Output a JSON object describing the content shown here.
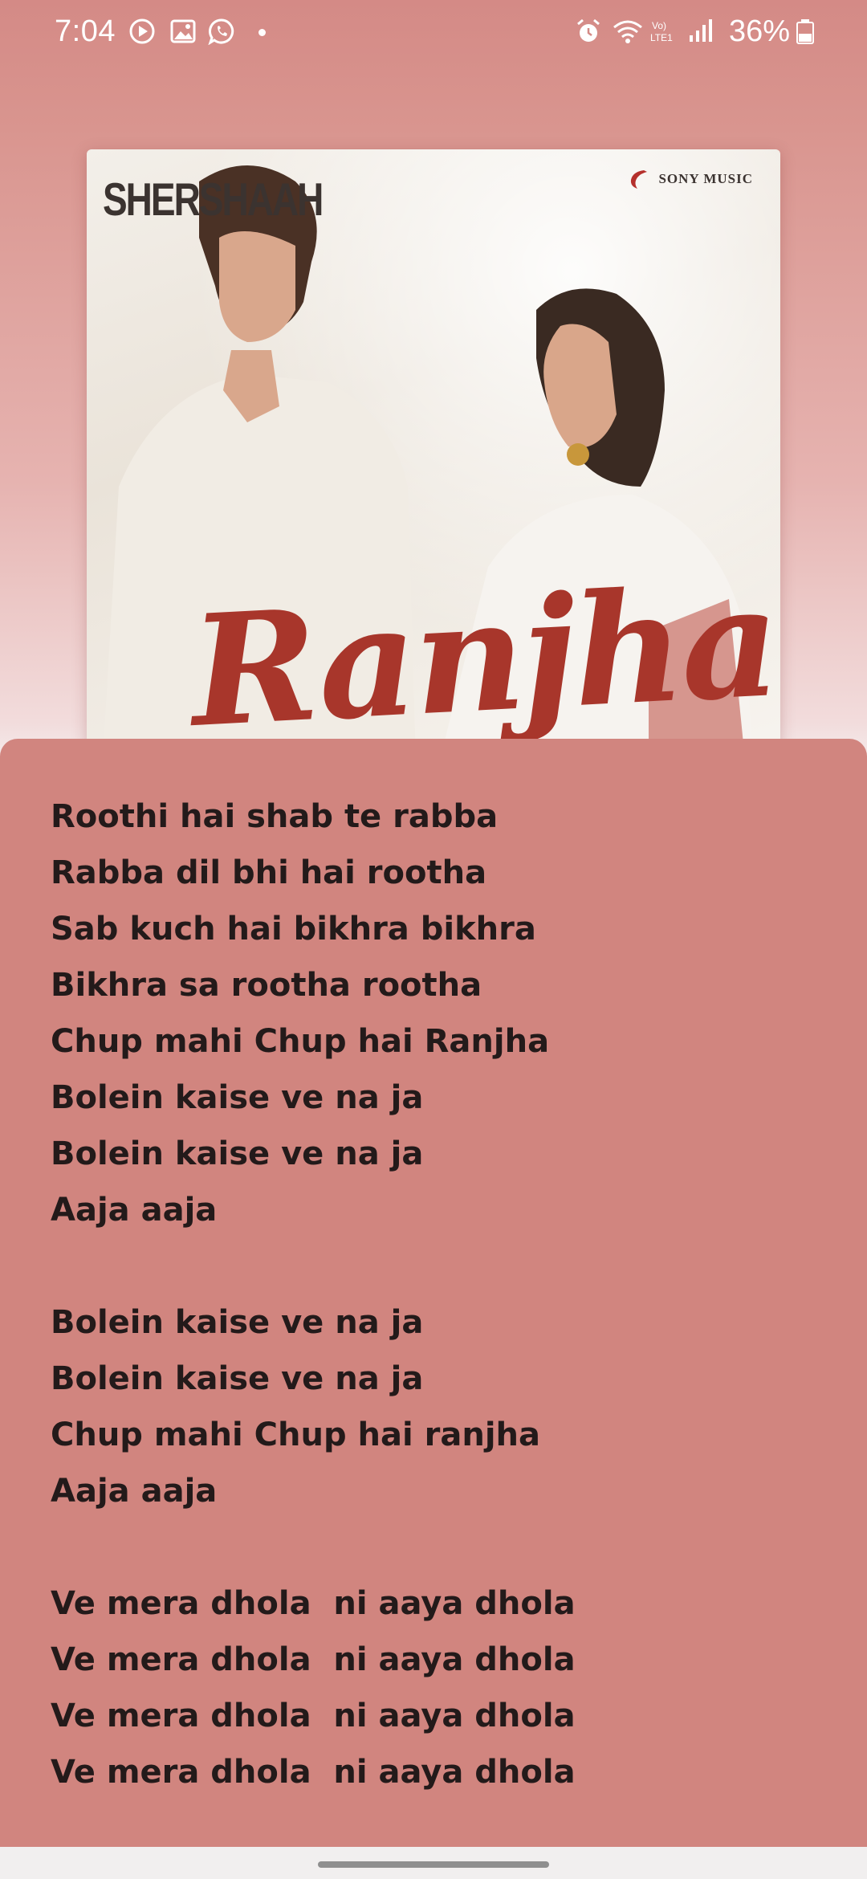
{
  "status_bar": {
    "time": "7:04",
    "battery": "36%",
    "left_icons": [
      "play-circle-icon",
      "image-icon",
      "whatsapp-icon",
      "dot-icon"
    ],
    "right_icons": [
      "alarm-icon",
      "wifi-icon",
      "volte-icon",
      "signal-icon",
      "battery-icon"
    ],
    "volte_label": "Vo) LTE1"
  },
  "album": {
    "label_left": "SHERSHAAH",
    "label_right": "SONY MUSIC",
    "title": "Ranjha"
  },
  "lyrics": {
    "text": "Roothi hai shab te rabba\nRabba dil bhi hai rootha\nSab kuch hai bikhra bikhra\nBikhra sa rootha rootha\nChup mahi Chup hai Ranjha\nBolein kaise ve na ja\nBolein kaise ve na ja\nAaja aaja\n\nBolein kaise ve na ja\nBolein kaise ve na ja\nChup mahi Chup hai ranjha\nAaja aaja\n\nVe mera dhola  ni aaya dhola\nVe mera dhola  ni aaya dhola\nVe mera dhola  ni aaya dhola\nVe mera dhola  ni aaya dhola"
  },
  "colors": {
    "panel": "#d1857f",
    "status_bg": "#d48a86",
    "text": "#231a1a",
    "title_red": "#a8362b"
  }
}
